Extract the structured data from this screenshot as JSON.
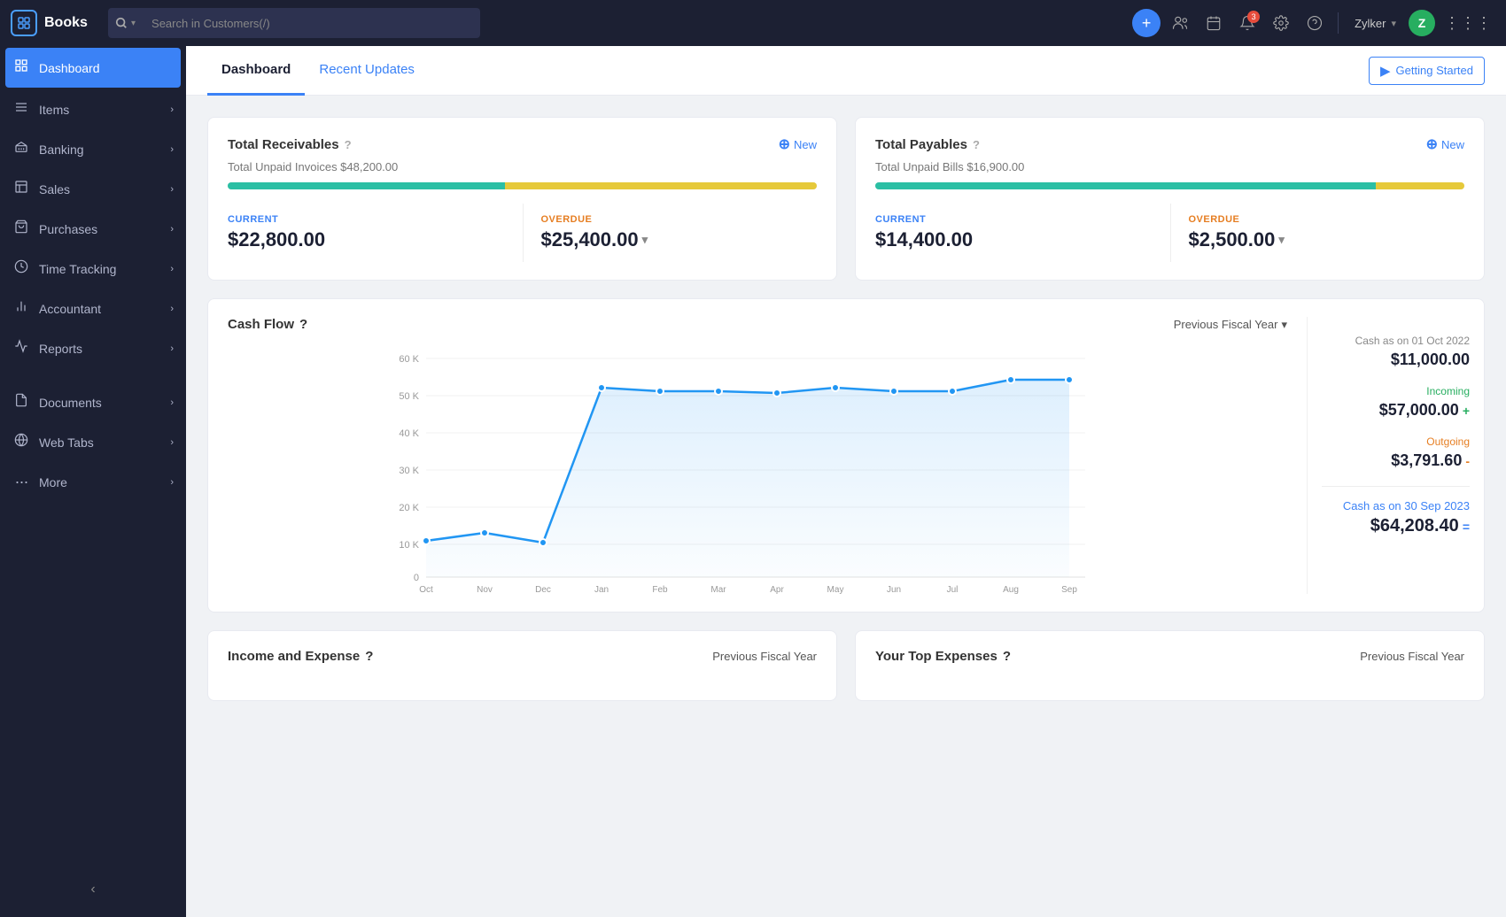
{
  "app": {
    "name": "Books",
    "logo_initial": "B"
  },
  "topnav": {
    "search_placeholder": "Search in Customers(/)",
    "add_btn": "+",
    "user_name": "Zylker",
    "user_initial": "Z",
    "notification_count": "3"
  },
  "sidebar": {
    "items": [
      {
        "id": "dashboard",
        "label": "Dashboard",
        "icon": "⊙",
        "active": true,
        "has_children": false
      },
      {
        "id": "items",
        "label": "Items",
        "icon": "☰",
        "active": false,
        "has_children": true
      },
      {
        "id": "banking",
        "label": "Banking",
        "icon": "🏦",
        "active": false,
        "has_children": true
      },
      {
        "id": "sales",
        "label": "Sales",
        "icon": "◻",
        "active": false,
        "has_children": true
      },
      {
        "id": "purchases",
        "label": "Purchases",
        "icon": "🛍",
        "active": false,
        "has_children": true
      },
      {
        "id": "time-tracking",
        "label": "Time Tracking",
        "icon": "⏱",
        "active": false,
        "has_children": true
      },
      {
        "id": "accountant",
        "label": "Accountant",
        "icon": "📊",
        "active": false,
        "has_children": true
      },
      {
        "id": "reports",
        "label": "Reports",
        "icon": "📈",
        "active": false,
        "has_children": true
      },
      {
        "id": "documents",
        "label": "Documents",
        "icon": "📄",
        "active": false,
        "has_children": true
      },
      {
        "id": "web-tabs",
        "label": "Web Tabs",
        "icon": "🌐",
        "active": false,
        "has_children": true
      },
      {
        "id": "more",
        "label": "More",
        "icon": "···",
        "active": false,
        "has_children": true
      }
    ],
    "collapse_icon": "‹"
  },
  "tabs": [
    {
      "id": "dashboard",
      "label": "Dashboard",
      "active": true,
      "highlight": false
    },
    {
      "id": "recent-updates",
      "label": "Recent Updates",
      "active": false,
      "highlight": true
    }
  ],
  "getting_started": {
    "label": "Getting Started",
    "icon": "▶"
  },
  "receivables": {
    "title": "Total Receivables",
    "new_btn": "New",
    "subtitle": "Total Unpaid Invoices $48,200.00",
    "current_label": "CURRENT",
    "current_value": "$22,800.00",
    "overdue_label": "OVERDUE",
    "overdue_value": "$25,400.00",
    "current_pct": 47,
    "overdue_pct": 53
  },
  "payables": {
    "title": "Total Payables",
    "new_btn": "New",
    "subtitle": "Total Unpaid Bills $16,900.00",
    "current_label": "CURRENT",
    "current_value": "$14,400.00",
    "overdue_label": "OVERDUE",
    "overdue_value": "$2,500.00",
    "current_pct": 85,
    "overdue_pct": 15
  },
  "cashflow": {
    "title": "Cash Flow",
    "period_label": "Previous Fiscal Year",
    "x_labels": [
      "Oct\n2022",
      "Nov\n2022",
      "Dec\n2022",
      "Jan\n2023",
      "Feb\n2023",
      "Mar\n2023",
      "Apr\n2023",
      "May\n2023",
      "Jun\n2023",
      "Jul\n2023",
      "Aug\n2023",
      "Sep\n2023"
    ],
    "y_labels": [
      "60 K",
      "50 K",
      "40 K",
      "30 K",
      "20 K",
      "10 K",
      "0"
    ],
    "stats": {
      "opening_label": "Cash as on 01 Oct 2022",
      "opening_value": "$11,000.00",
      "incoming_label": "Incoming",
      "incoming_value": "$57,000.00",
      "incoming_sign": "+",
      "outgoing_label": "Outgoing",
      "outgoing_value": "$3,791.60",
      "outgoing_sign": "-",
      "closing_label": "Cash as on 30 Sep 2023",
      "closing_value": "$64,208.40",
      "closing_sign": "="
    }
  },
  "income_expense": {
    "title": "Income and Expense",
    "period_label": "Previous Fiscal Year"
  },
  "top_expenses": {
    "title": "Your Top Expenses",
    "period_label": "Previous Fiscal Year"
  }
}
